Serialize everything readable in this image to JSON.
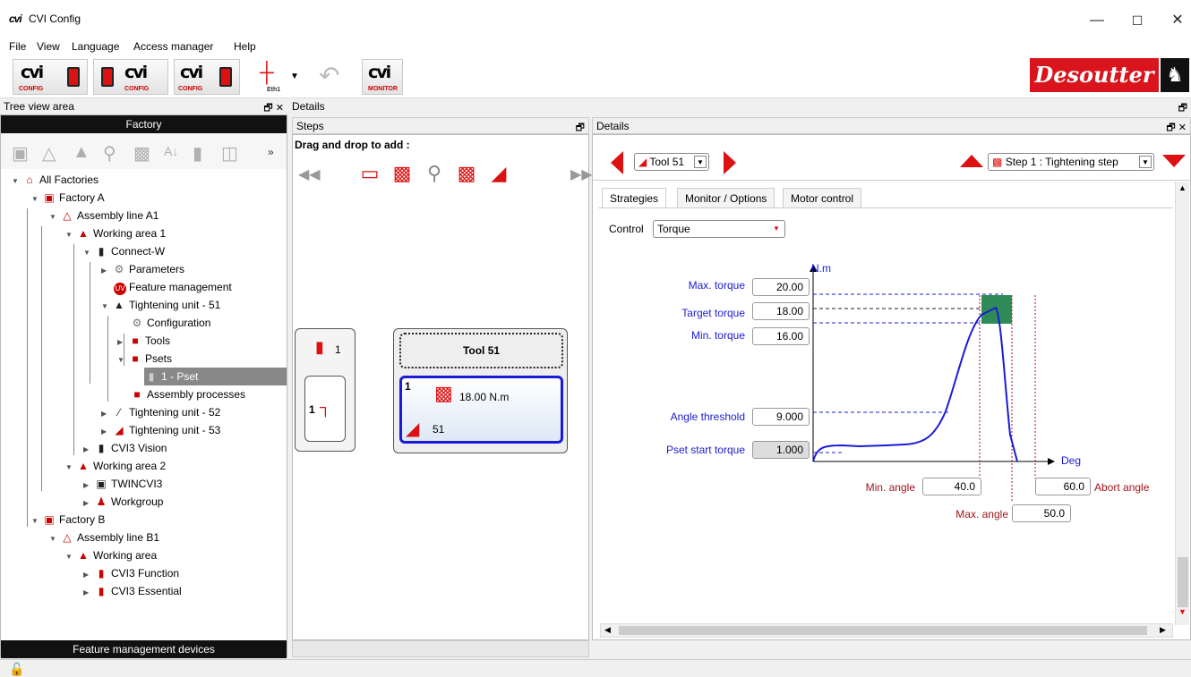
{
  "window": {
    "title": "CVI Config",
    "icon": "cvi-logo-icon"
  },
  "menu": [
    "File",
    "View",
    "Language",
    "Access manager",
    "Help"
  ],
  "toolbar": {
    "buttons": [
      {
        "main": "cvi",
        "sub": "CONFIG"
      },
      {
        "main": "cvi",
        "sub": "CONFIG"
      },
      {
        "main": "cvi",
        "sub": "CONFIG"
      },
      {
        "main": "",
        "sub": "Eth1"
      },
      {
        "main": "",
        "sub": ""
      },
      {
        "main": "cvi",
        "sub": "MONITOR"
      }
    ],
    "brand": "Desoutter"
  },
  "tree_panel": {
    "title": "Tree view area",
    "header": "Factory",
    "footer": "Feature management devices",
    "items": [
      {
        "label": "All Factories"
      },
      {
        "label": "Factory A"
      },
      {
        "label": "Assembly line A1"
      },
      {
        "label": "Working area 1"
      },
      {
        "label": "Connect-W"
      },
      {
        "label": "Parameters"
      },
      {
        "label": "Feature management"
      },
      {
        "label": "Tightening unit - 51"
      },
      {
        "label": "Configuration"
      },
      {
        "label": "Tools"
      },
      {
        "label": "Psets"
      },
      {
        "label": "1 - Pset"
      },
      {
        "label": "Assembly processes"
      },
      {
        "label": "Tightening unit - 52"
      },
      {
        "label": "Tightening unit - 53"
      },
      {
        "label": "CVI3 Vision"
      },
      {
        "label": "Working area 2"
      },
      {
        "label": "TWINCVI3"
      },
      {
        "label": "Workgroup"
      },
      {
        "label": "Factory B"
      },
      {
        "label": "Assembly line B1"
      },
      {
        "label": "Working area"
      },
      {
        "label": "CVI3 Function"
      },
      {
        "label": "CVI3 Essential"
      }
    ]
  },
  "details_outer_title": "Details",
  "steps": {
    "title": "Steps",
    "drag_label": "Drag and drop to add :",
    "tool_count": "1",
    "step_number": "1",
    "tool_name": "Tool 51",
    "step_index": "1",
    "step_value": "18.00 N.m",
    "tool_ref": "51"
  },
  "details": {
    "title": "Details",
    "tool_combo": "Tool 51",
    "step_combo": "Step 1 : Tightening step",
    "tabs": [
      "Strategies",
      "Monitor / Options",
      "Motor control"
    ],
    "control_label": "Control",
    "control_value": "Torque",
    "chart": {
      "y_unit": "N.m",
      "x_unit": "Deg",
      "max_torque_label": "Max. torque",
      "max_torque": "20.00",
      "target_torque_label": "Target torque",
      "target_torque": "18.00",
      "min_torque_label": "Min. torque",
      "min_torque": "16.00",
      "angle_threshold_label": "Angle threshold",
      "angle_threshold": "9.000",
      "pset_start_label": "Pset start torque",
      "pset_start": "1.000",
      "min_angle_label": "Min. angle",
      "min_angle": "40.0",
      "max_angle_label": "Max. angle",
      "max_angle": "50.0",
      "abort_angle_label": "Abort angle",
      "abort_angle": "60.0"
    }
  }
}
